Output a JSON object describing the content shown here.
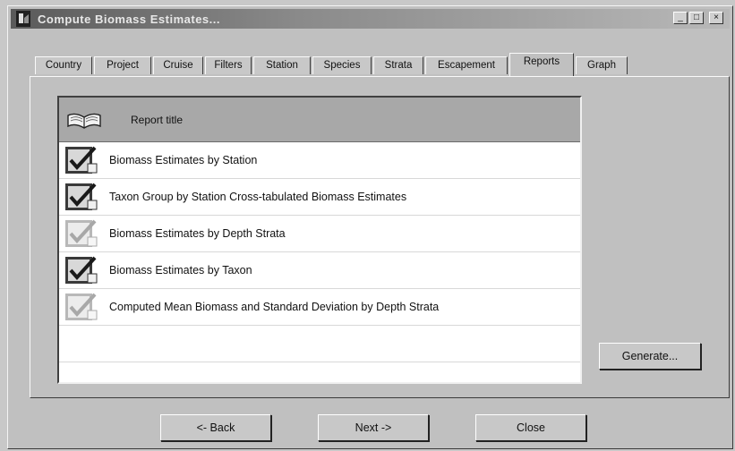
{
  "window": {
    "title": "Compute Biomass Estimates...",
    "minimize_glyph": "_",
    "maximize_glyph": "□",
    "close_glyph": "×"
  },
  "tabs": [
    {
      "label": "Country",
      "active": false
    },
    {
      "label": "Project",
      "active": false
    },
    {
      "label": "Cruise",
      "active": false
    },
    {
      "label": "Filters",
      "active": false
    },
    {
      "label": "Station",
      "active": false
    },
    {
      "label": "Species",
      "active": false
    },
    {
      "label": "Strata",
      "active": false
    },
    {
      "label": "Escapement",
      "active": false
    },
    {
      "label": "Reports",
      "active": true
    },
    {
      "label": "Graph",
      "active": false
    }
  ],
  "report_list": {
    "header_icon": "open-book-icon",
    "header_label": "Report title",
    "items": [
      {
        "label": "Biomass Estimates by Station",
        "checked": true
      },
      {
        "label": "Taxon Group by Station Cross-tabulated Biomass Estimates",
        "checked": true
      },
      {
        "label": "Biomass Estimates by Depth Strata",
        "checked": false
      },
      {
        "label": "Biomass Estimates by Taxon",
        "checked": true
      },
      {
        "label": "Computed Mean Biomass and Standard Deviation by Depth Strata",
        "checked": false
      }
    ]
  },
  "buttons": {
    "generate": "Generate...",
    "back": "<- Back",
    "next": "Next ->",
    "close": "Close"
  },
  "colors": {
    "window_bg": "#c0c0c0",
    "list_header_bg": "#a8a8a8",
    "list_bg": "#ffffff",
    "check_dark": "#3a3a3a",
    "check_light": "#b8b8b8"
  }
}
